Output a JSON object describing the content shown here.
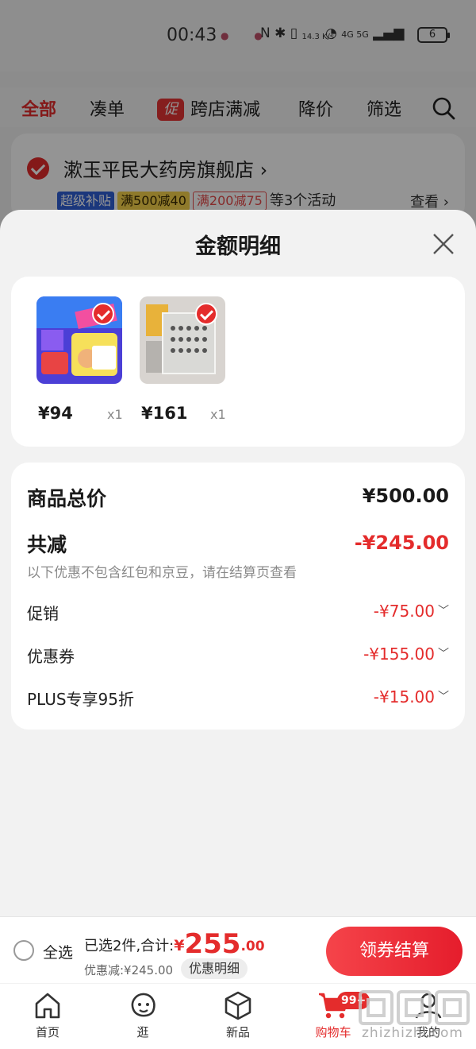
{
  "status_bar": {
    "time": "00:43",
    "network_speed": "14.3 K/s",
    "signal_labels": "4G 5G",
    "battery": "6"
  },
  "cart_tabs": {
    "items": [
      "全部",
      "凑单",
      "跨店满减",
      "降价",
      "筛选"
    ],
    "promo_badge": "促"
  },
  "store": {
    "name": "漱玉平民大药房旗舰店 ›",
    "tags": [
      "超级补贴",
      "满500减40",
      "满200减75"
    ],
    "more_text": "等3个活动",
    "view_text": "查看 ›"
  },
  "sheet": {
    "title": "金额明细",
    "products": [
      {
        "price": "¥94",
        "qty": "x1"
      },
      {
        "price": "¥161",
        "qty": "x1"
      }
    ],
    "total_label": "商品总价",
    "total_value": "¥500.00",
    "reduce_label": "共减",
    "reduce_value": "-¥245.00",
    "note": "以下优惠不包含红包和京豆，请在结算页查看",
    "items": [
      {
        "label": "促销",
        "value": "-¥75.00"
      },
      {
        "label": "优惠券",
        "value": "-¥155.00"
      },
      {
        "label": "PLUS专享95折",
        "value": "-¥15.00"
      }
    ]
  },
  "checkout": {
    "select_all": "全选",
    "selected_text": "已选2件,合计:",
    "sum_yen": "¥",
    "sum_int": "255",
    "sum_dec": ".00",
    "discount_text": "优惠减:¥245.00",
    "detail_button": "优惠明细",
    "checkout_button": "领券结算"
  },
  "tab_bar": {
    "items": [
      "首页",
      "逛",
      "新品",
      "购物车",
      "我的"
    ],
    "cart_badge": "99+"
  },
  "watermark": "zhizhizhi.com",
  "colors": {
    "accent": "#e42c2c",
    "background": "#f2f2f2"
  }
}
